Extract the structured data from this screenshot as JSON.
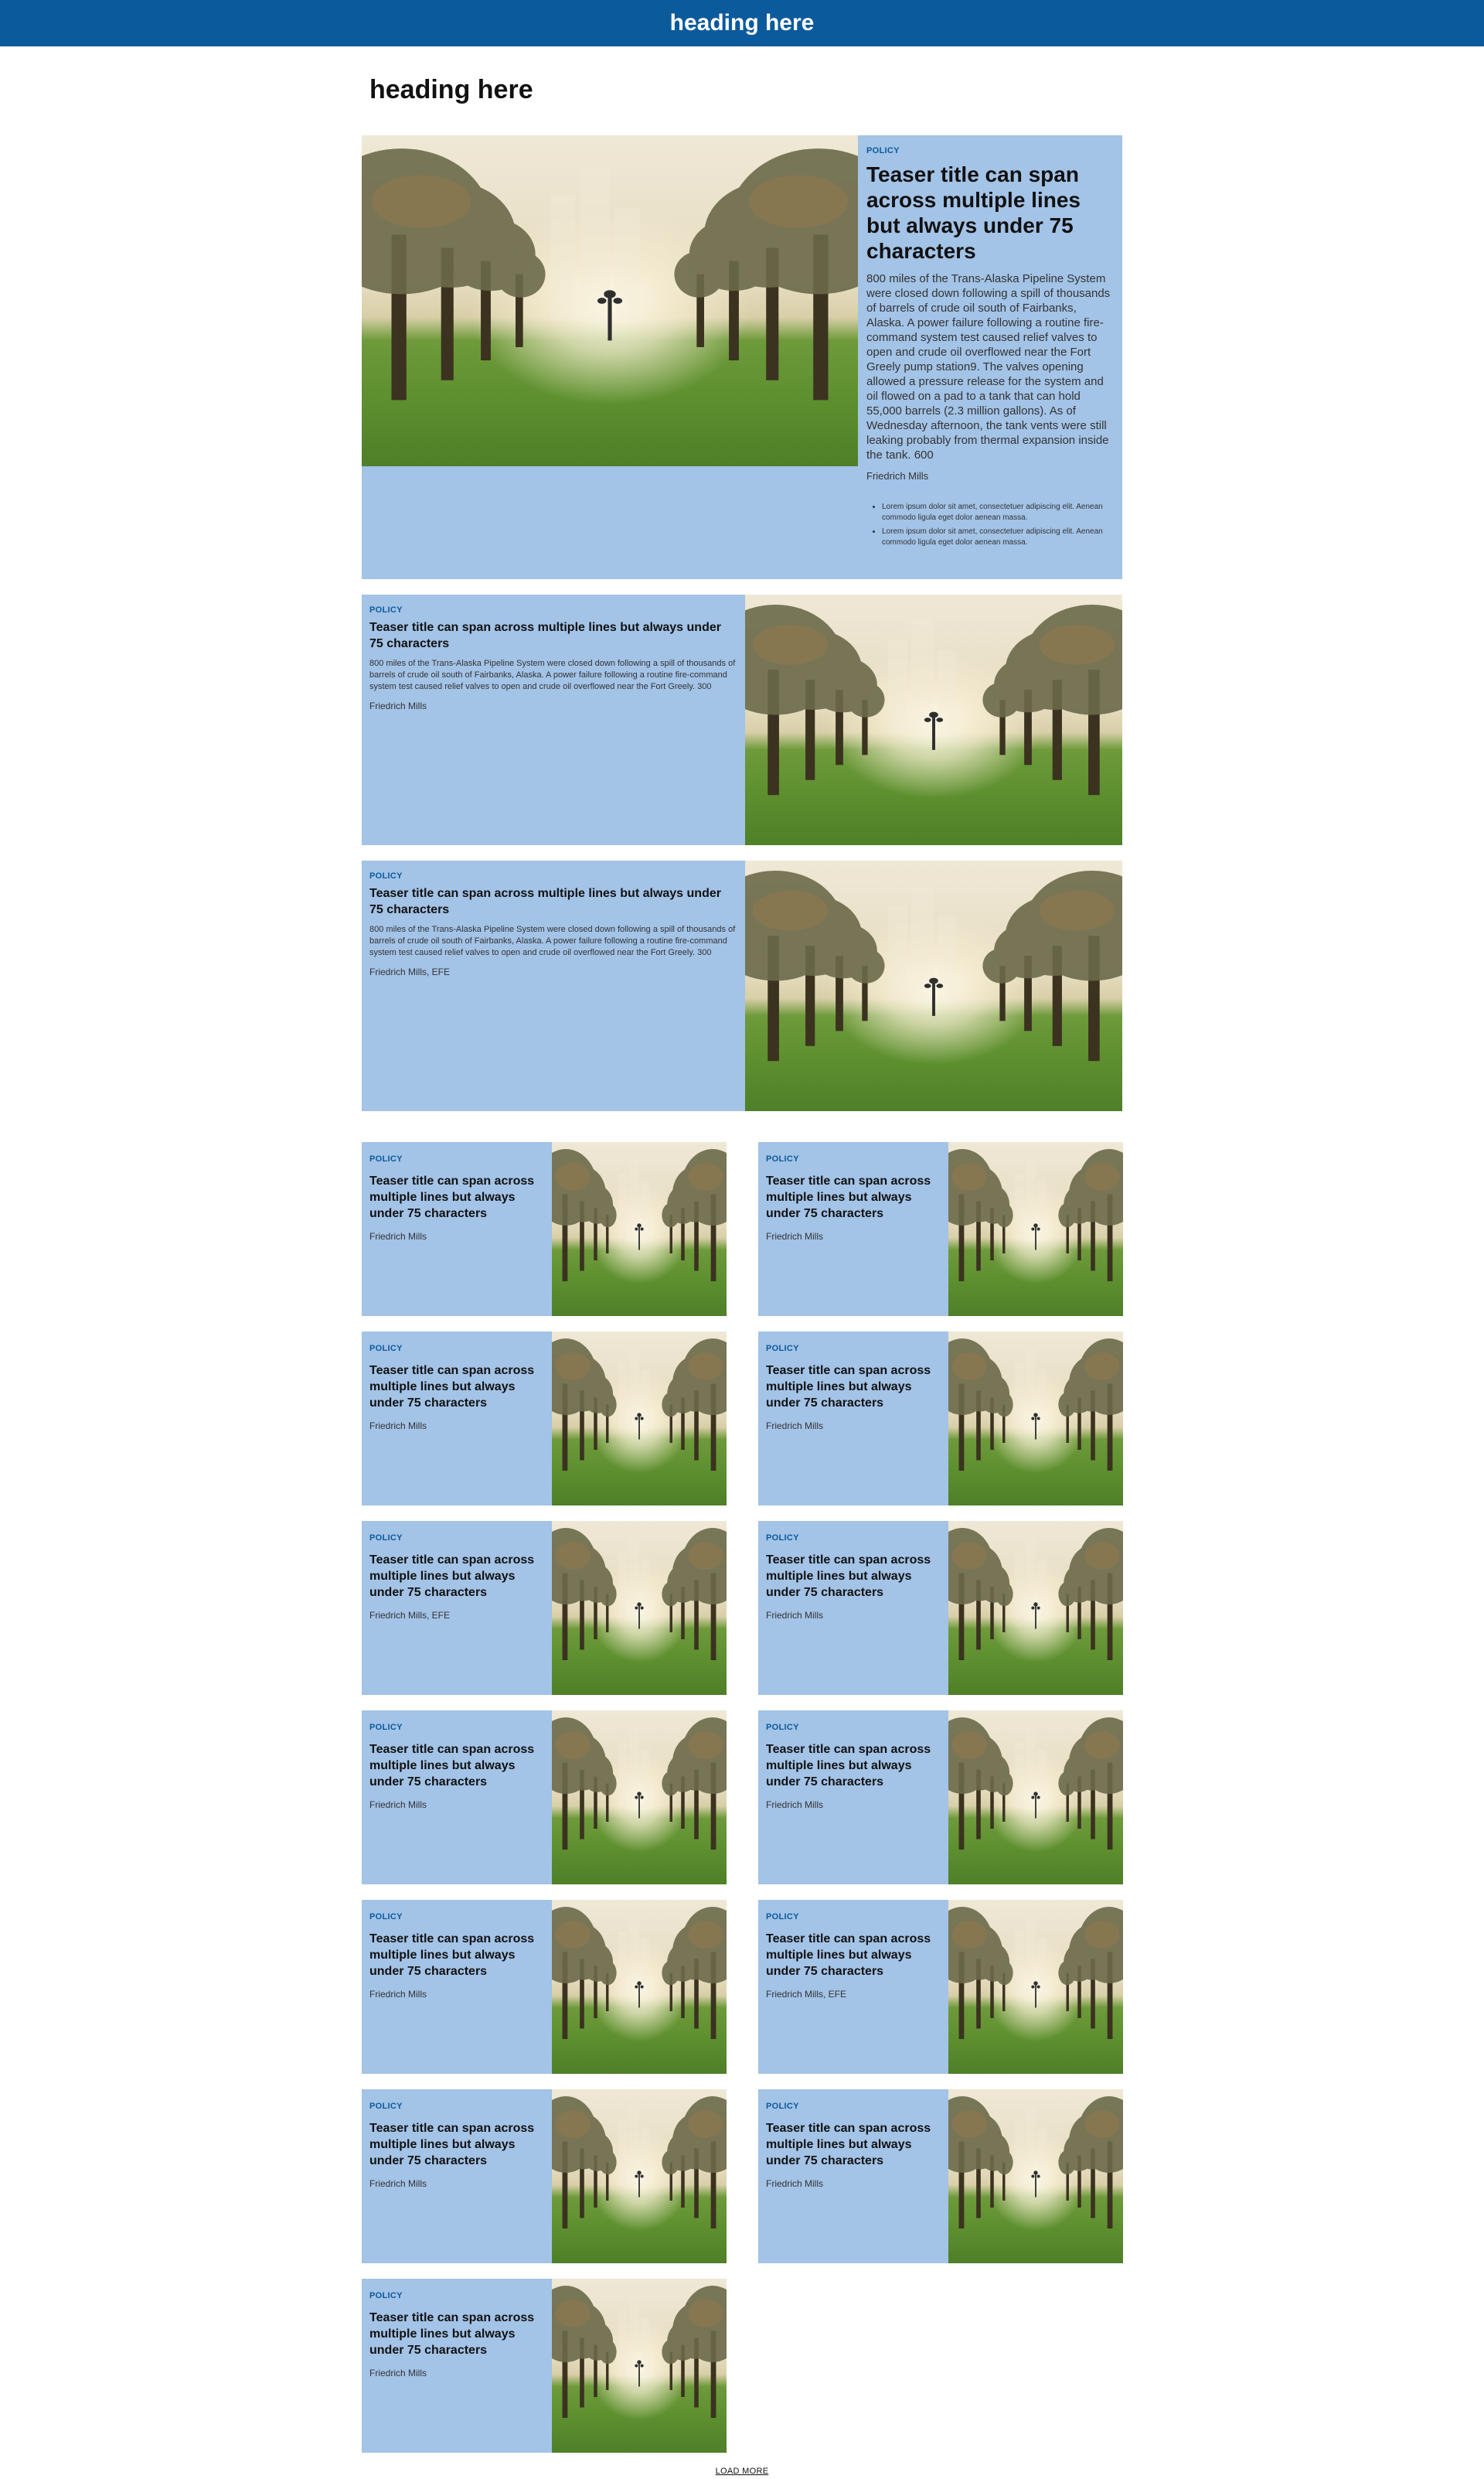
{
  "header": {
    "title": "heading here"
  },
  "page": {
    "heading": "heading here"
  },
  "feature": {
    "kicker": "POLICY",
    "title": "Teaser title can span across multiple lines but always under 75 characters",
    "body": "800 miles of the Trans-Alaska Pipeline System were closed down following a spill of thousands of barrels of crude oil south of Fairbanks, Alaska. A power failure following a routine fire-command system test caused relief valves to open and crude oil overflowed near the Fort Greely pump station9. The valves opening allowed a pressure release for the system and oil flowed on a pad to a tank that can hold 55,000 barrels (2.3 million gallons). As of Wednesday afternoon, the tank vents were still leaking probably from thermal expansion inside the tank. 600",
    "author": "Friedrich Mills",
    "bullets": [
      "Lorem ipsum dolor sit amet, consectetuer adipiscing elit. Aenean commodo ligula eget dolor aenean massa.",
      "Lorem ipsum dolor sit amet, consectetuer adipiscing elit. Aenean commodo ligula eget dolor aenean massa."
    ]
  },
  "medium": [
    {
      "kicker": "POLICY",
      "title": "Teaser title can span across multiple lines but always under 75 characters",
      "body": "800 miles of the Trans-Alaska Pipeline System were closed down following a spill of thousands of barrels of crude oil south of Fairbanks, Alaska. A power failure following a routine fire-command system test caused relief valves to open and crude oil overflowed near the Fort Greely. 300",
      "author": "Friedrich Mills"
    },
    {
      "kicker": "POLICY",
      "title": "Teaser title can span across multiple lines but always under 75 characters",
      "body": "800 miles of the Trans-Alaska Pipeline System were closed down following a spill of thousands of barrels of crude oil south of Fairbanks, Alaska. A power failure following a routine fire-command system test caused relief valves to open and crude oil overflowed near the Fort Greely. 300",
      "author": "Friedrich Mills, EFE"
    }
  ],
  "small": [
    {
      "kicker": "POLICY",
      "title": "Teaser title can span across multiple lines but always under 75 characters",
      "author": "Friedrich Mills"
    },
    {
      "kicker": "POLICY",
      "title": "Teaser title can span across multiple lines but always under 75 characters",
      "author": "Friedrich Mills"
    },
    {
      "kicker": "POLICY",
      "title": "Teaser title can span across multiple lines but always under 75 characters",
      "author": "Friedrich Mills"
    },
    {
      "kicker": "POLICY",
      "title": "Teaser title can span across multiple lines but always under 75 characters",
      "author": "Friedrich Mills"
    },
    {
      "kicker": "POLICY",
      "title": "Teaser title can span across multiple lines but always under 75 characters",
      "author": "Friedrich Mills, EFE"
    },
    {
      "kicker": "POLICY",
      "title": "Teaser title can span across multiple lines but always under 75 characters",
      "author": "Friedrich Mills"
    },
    {
      "kicker": "POLICY",
      "title": "Teaser title can span across multiple lines but always under 75 characters",
      "author": "Friedrich Mills"
    },
    {
      "kicker": "POLICY",
      "title": "Teaser title can span across multiple lines but always under 75 characters",
      "author": "Friedrich Mills"
    },
    {
      "kicker": "POLICY",
      "title": "Teaser title can span across multiple lines but always under 75 characters",
      "author": "Friedrich Mills"
    },
    {
      "kicker": "POLICY",
      "title": "Teaser title can span across multiple lines but always under 75 characters",
      "author": "Friedrich Mills, EFE"
    },
    {
      "kicker": "POLICY",
      "title": "Teaser title can span across multiple lines but always under 75 characters",
      "author": "Friedrich Mills"
    },
    {
      "kicker": "POLICY",
      "title": "Teaser title can span across multiple lines but always under 75 characters",
      "author": "Friedrich Mills"
    },
    {
      "kicker": "POLICY",
      "title": "Teaser title can span across multiple lines but always under 75 characters",
      "author": "Friedrich Mills"
    }
  ],
  "footer": {
    "load_more": "LOAD MORE"
  },
  "colors": {
    "header_bg": "#0b5a9c",
    "card_bg": "#a3c3e7",
    "kicker": "#0b5a9c"
  }
}
